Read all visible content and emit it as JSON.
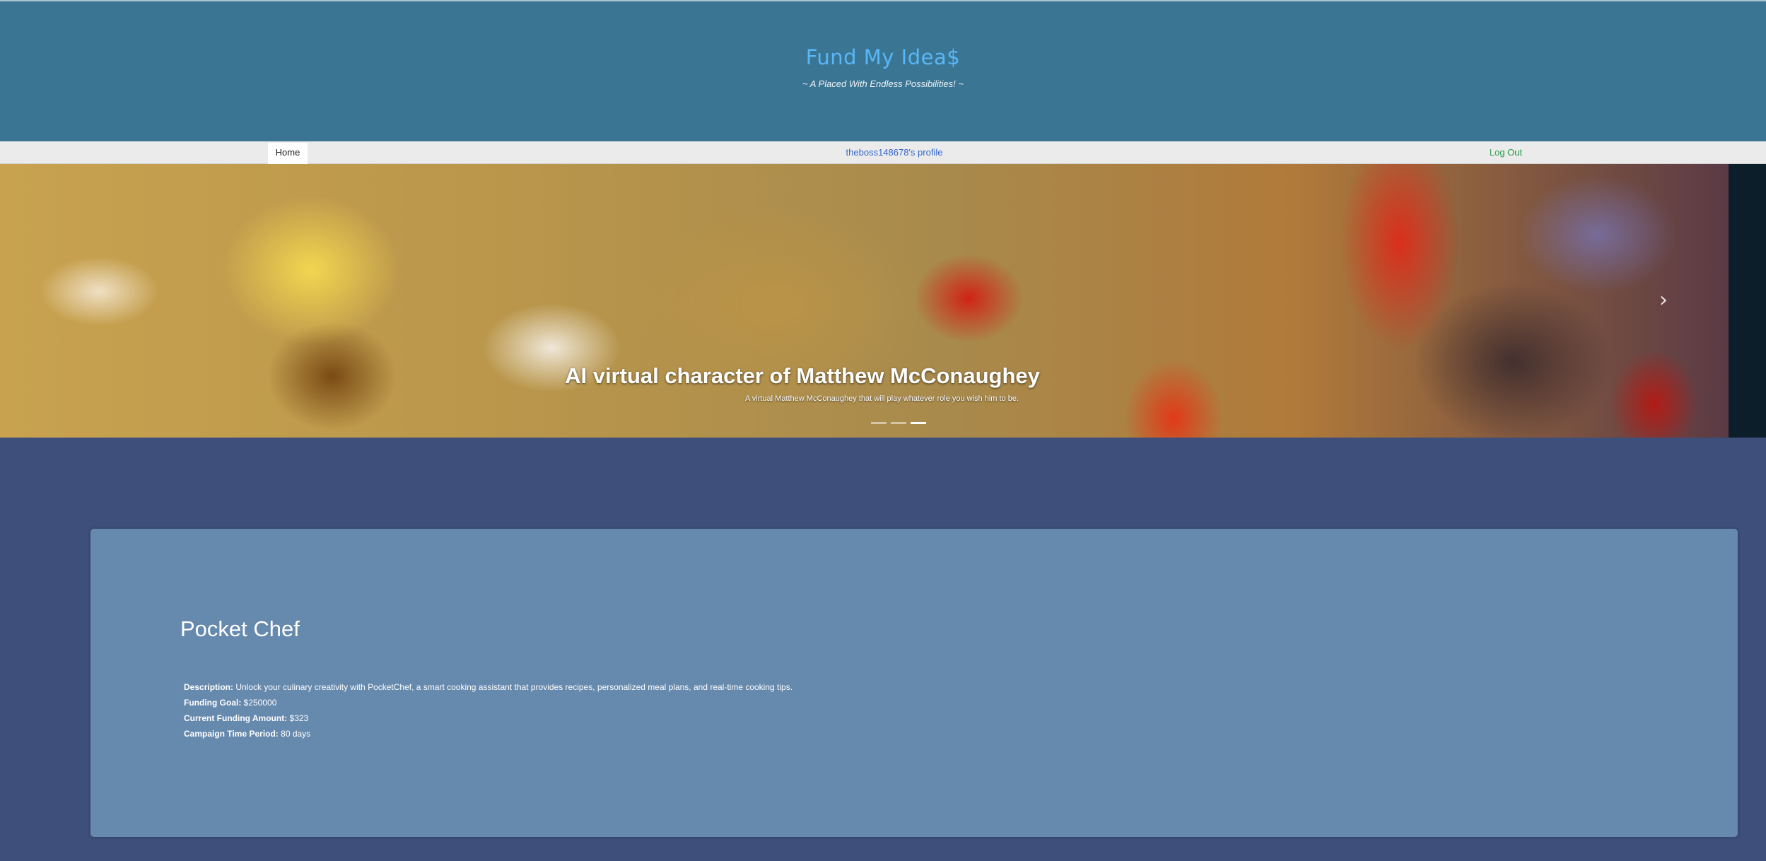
{
  "header": {
    "title": "Fund My Idea$",
    "tagline": "~ A Placed With Endless Possibilities! ~"
  },
  "nav": {
    "home": "Home",
    "profile": "theboss148678's profile",
    "logout": "Log Out"
  },
  "carousel": {
    "title": "AI virtual character of Matthew McConaughey",
    "text": "A virtual Matthew McConaughey that will play whatever role you wish him to be.",
    "next_icon": "chevron-right-icon",
    "next_glyph": "›",
    "slide_count": 3,
    "active_slide": 3
  },
  "campaign": {
    "title": "Pocket Chef",
    "description_label": "Description:",
    "description": "Unlock your culinary creativity with PocketChef, a smart cooking assistant that provides recipes, personalized meal plans, and real-time cooking tips.",
    "goal_label": "Funding Goal:",
    "goal": "$250000",
    "current_label": "Current Funding Amount:",
    "current": "$323",
    "period_label": "Campaign Time Period:",
    "period": "80 days"
  },
  "colors": {
    "header_bg": "#3b7594",
    "title": "#58b7f7",
    "page_bg": "#3d4f7a",
    "card_bg": "#6689ae",
    "profile_link": "#3366cc",
    "logout_link": "#2e9e4f"
  }
}
